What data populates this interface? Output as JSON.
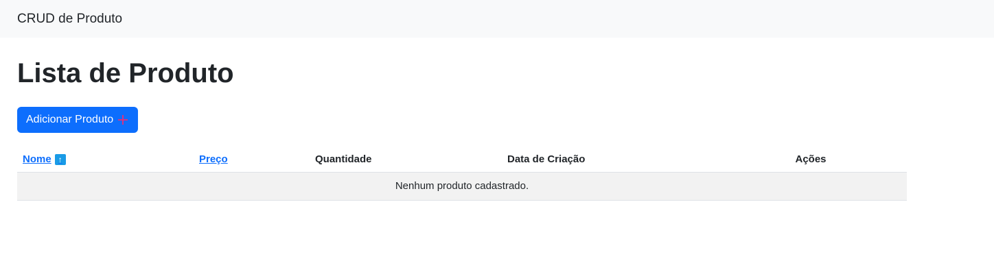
{
  "navbar": {
    "brand": "CRUD de Produto"
  },
  "page": {
    "title": "Lista de Produto",
    "add_button_label": "Adicionar Produto"
  },
  "table": {
    "columns": {
      "nome": "Nome",
      "preco": "Preço",
      "quantidade": "Quantidade",
      "data_criacao": "Data de Criação",
      "acoes": "Ações"
    },
    "sort_icon": "arrow-up-icon",
    "empty_message": "Nenhum produto cadastrado."
  },
  "colors": {
    "primary": "#0d6efd",
    "navbar_bg": "#f8f9fa",
    "plus_icon": "#d63384",
    "sort_icon_bg": "#1a9be6"
  }
}
